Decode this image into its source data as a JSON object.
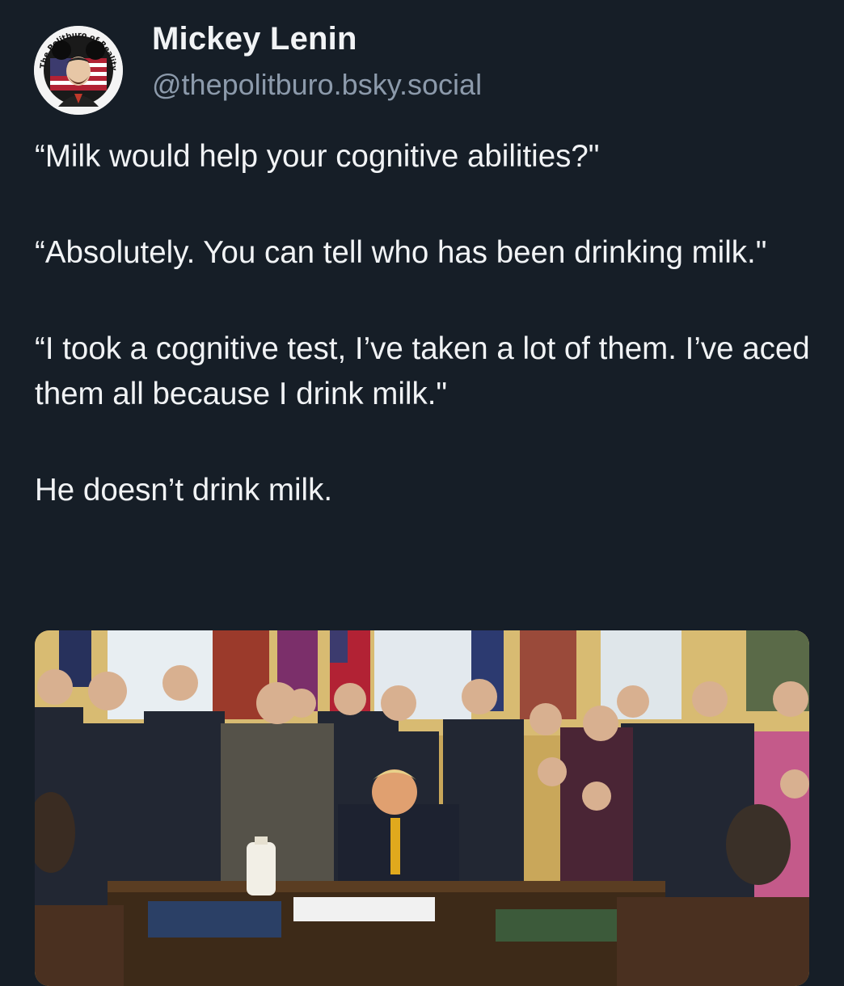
{
  "post": {
    "author": {
      "display_name": "Mickey Lenin",
      "handle": "@thepolitburo.bsky.social",
      "avatar_ring_text": "The Politburo of Reality Mockery",
      "avatar_icon": "mickey-lenin-avatar-icon"
    },
    "paragraphs": [
      "“Milk would help your cognitive abilities?\"",
      "“Absolutely. You can tell who has been drinking milk.\"",
      "“I took a cognitive test, I’ve taken a lot of them. I’ve aced them all because I drink milk.\"",
      "He doesn’t drink milk."
    ],
    "media": {
      "type": "photo",
      "icon": "oval-office-signing-photo"
    }
  },
  "colors": {
    "background": "#161e27",
    "text": "#f1f3f5",
    "handle": "#8c9aab"
  }
}
